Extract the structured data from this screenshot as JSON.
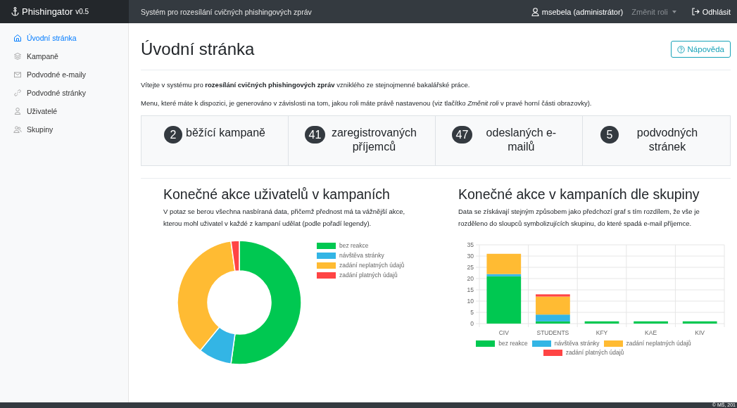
{
  "sidebar": {
    "brand": "Phishingator",
    "version": "v0.5",
    "items": [
      {
        "label": "Úvodní stránka",
        "selected": true
      },
      {
        "label": "Kampaně",
        "selected": false
      },
      {
        "label": "Podvodné e-maily",
        "selected": false
      },
      {
        "label": "Podvodné stránky",
        "selected": false
      },
      {
        "label": "Uživatelé",
        "selected": false
      },
      {
        "label": "Skupiny",
        "selected": false
      }
    ]
  },
  "navbar": {
    "title": "Systém pro rozesílání cvičných phishingových zpráv",
    "user": "msebela (administrátor)",
    "role_menu": "Změnit roli",
    "logout": "Odhlásit"
  },
  "page": {
    "title": "Úvodní stránka",
    "help_button": "Nápověda",
    "intro": "Vítejte v systému pro **rozesílání cvičných phishingových zpráv** vzniklého ze stejnojmenné bakalářské práce.",
    "menu_note": "Menu, které máte k dispozici, je generováno v závislosti na tom, jakou roli máte právě nastavenou (viz tlačítko *Změnit roli* v pravé horní části obrazovky)."
  },
  "stats": [
    {
      "count": "2",
      "label": "běžící kampaně"
    },
    {
      "count": "41",
      "label": "zaregistrovaných příjemců"
    },
    {
      "count": "47",
      "label": "odeslaných e-mailů"
    },
    {
      "count": "5",
      "label": "podvodných stránek"
    }
  ],
  "charts": [
    {
      "title": "Konečné akce uživatelů v kampaních",
      "description": "V potaz se berou všechna nasbíraná data, přičemž přednost má ta vážnější akce, kterou mohl uživatel v každé z kampaní udělat (podle pořadí legendy).",
      "chart_data": {
        "type": "donut",
        "categories": [
          "bez reakce",
          "návštěva stránky",
          "zadání neplatných údajů",
          "zadání platných údajů"
        ],
        "values": [
          52.17,
          8.7,
          36.96,
          2.17
        ],
        "colors": [
          "#00c851",
          "#33b5e5",
          "#ffbb33",
          "#ff4444"
        ]
      }
    },
    {
      "title": "Konečné akce v kampaních dle skupiny",
      "description": "Data se získávají stejným způsobem jako předchozí graf s tím rozdílem, že vše je rozděleno do sloupců symbolizujících skupinu, do které spadá e-mail příjemce.",
      "chart_data": {
        "type": "bar",
        "stacked": true,
        "grid": true,
        "categories": [
          "CIV",
          "STUDENTS",
          "KFY",
          "KAE",
          "KIV"
        ],
        "ylim": [
          0,
          35
        ],
        "yticks": [
          0,
          5,
          10,
          15,
          20,
          25,
          30,
          35
        ],
        "series": [
          {
            "name": "bez reakce",
            "color": "#00c851",
            "values": [
              21,
              1,
              1,
              1,
              1
            ]
          },
          {
            "name": "návštěva stránky",
            "color": "#33b5e5",
            "values": [
              1,
              3,
              0,
              0,
              0
            ]
          },
          {
            "name": "zadání neplatných údajů",
            "color": "#ffbb33",
            "values": [
              9,
              8,
              0,
              0,
              0
            ]
          },
          {
            "name": "zadání platných údajů",
            "color": "#ff4444",
            "values": [
              0,
              1,
              0,
              0,
              0
            ]
          }
        ]
      }
    }
  ],
  "footer": "© MŠ, 201"
}
